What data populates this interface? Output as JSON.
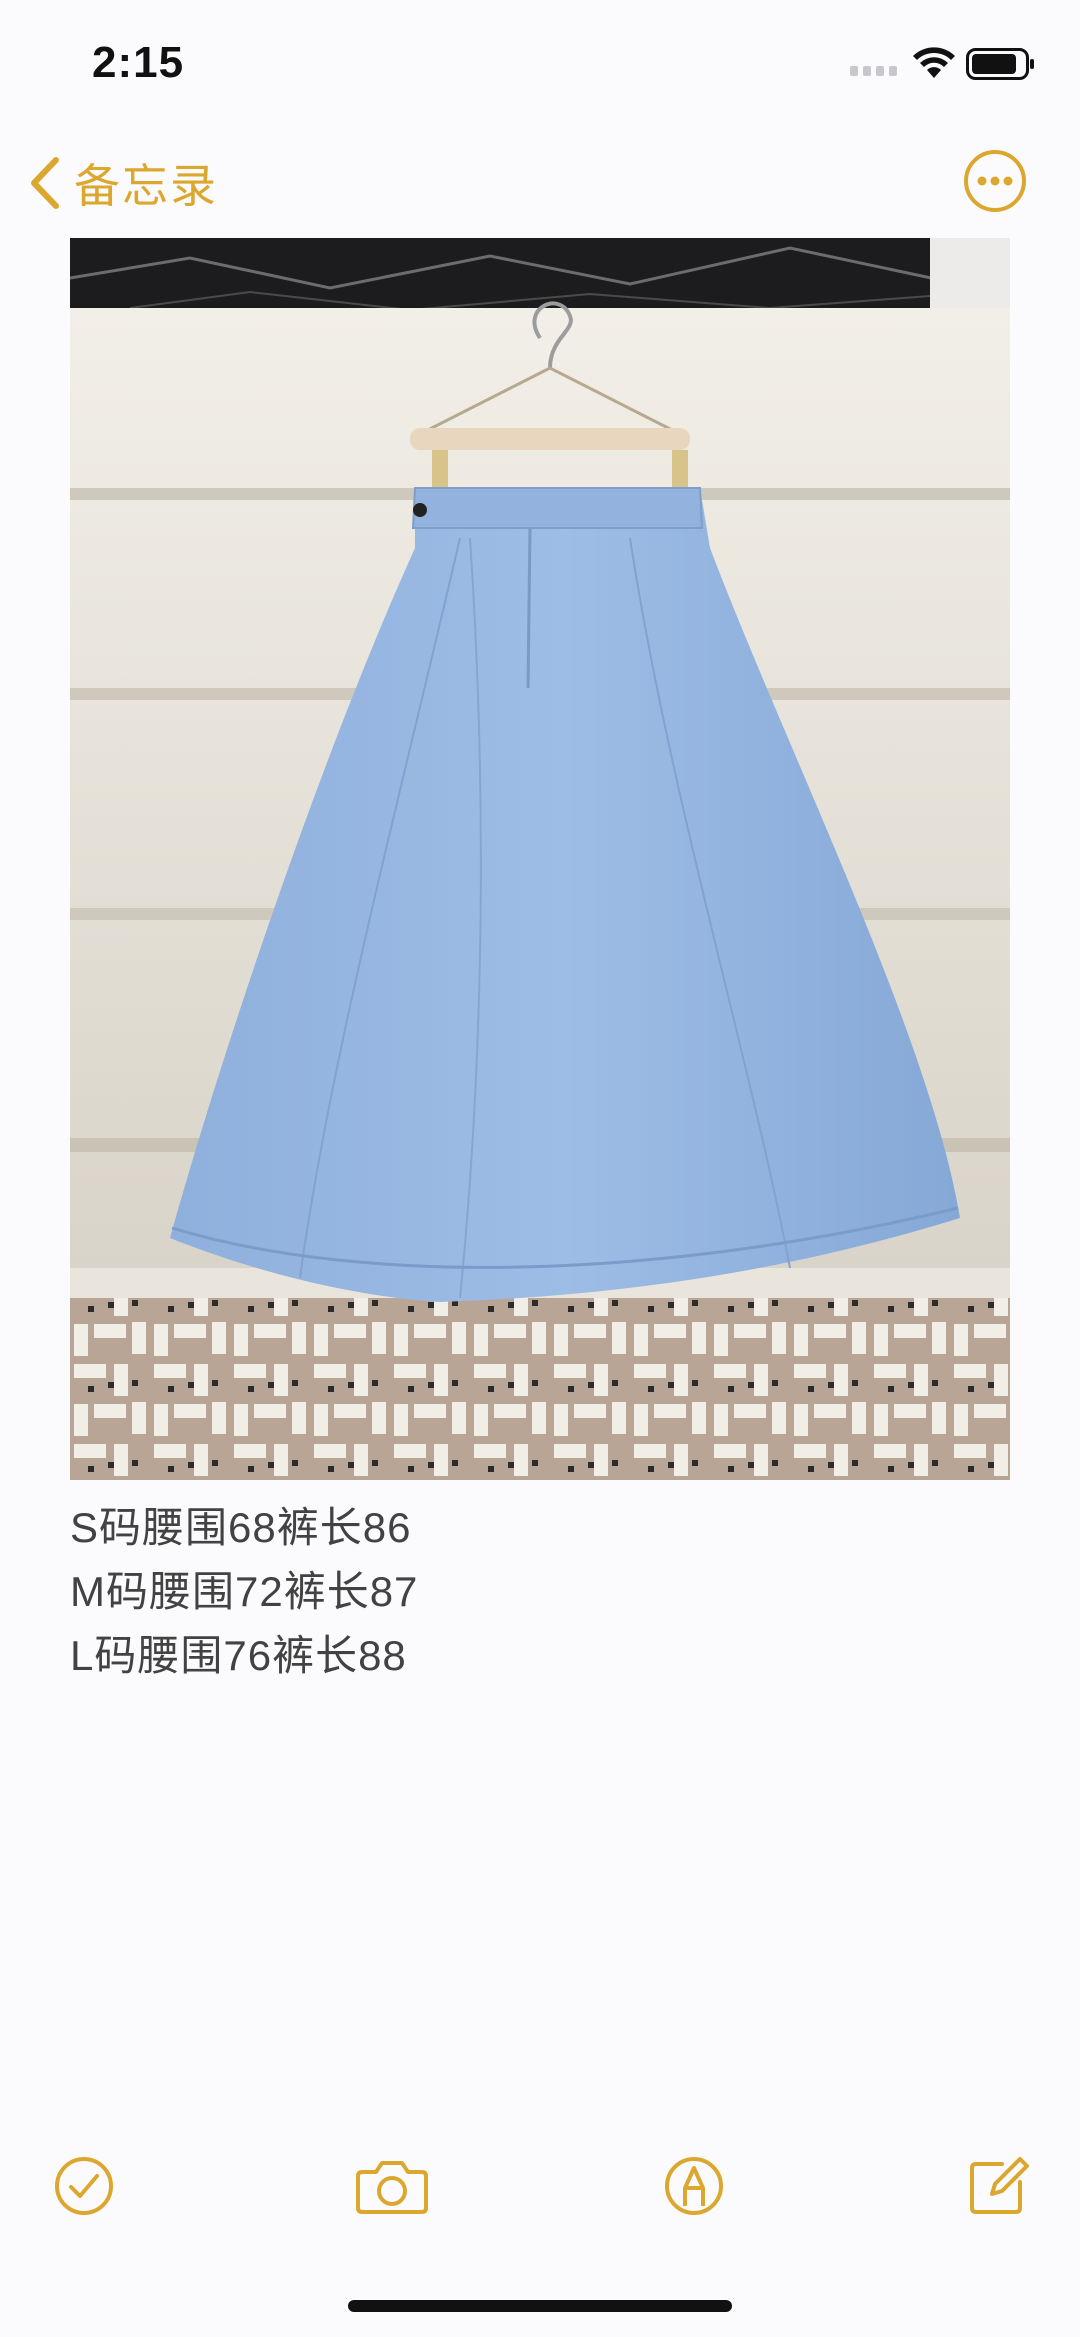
{
  "status_bar": {
    "time": "2:15"
  },
  "nav": {
    "back_label": "备忘录",
    "back_icon": "chevron-left-icon",
    "more_icon": "ellipsis-circle-icon"
  },
  "note": {
    "photo_subject": "blue-skirt-photo",
    "lines": [
      "S码腰围68裤长86",
      "M码腰围72裤长87",
      "L码腰围76裤长88"
    ]
  },
  "toolbar": {
    "items": [
      "checklist-icon",
      "camera-icon",
      "markup-pen-icon",
      "compose-icon"
    ]
  },
  "colors": {
    "accent": "#dca72e",
    "text": "#424242",
    "background": "#fbfbfd"
  }
}
